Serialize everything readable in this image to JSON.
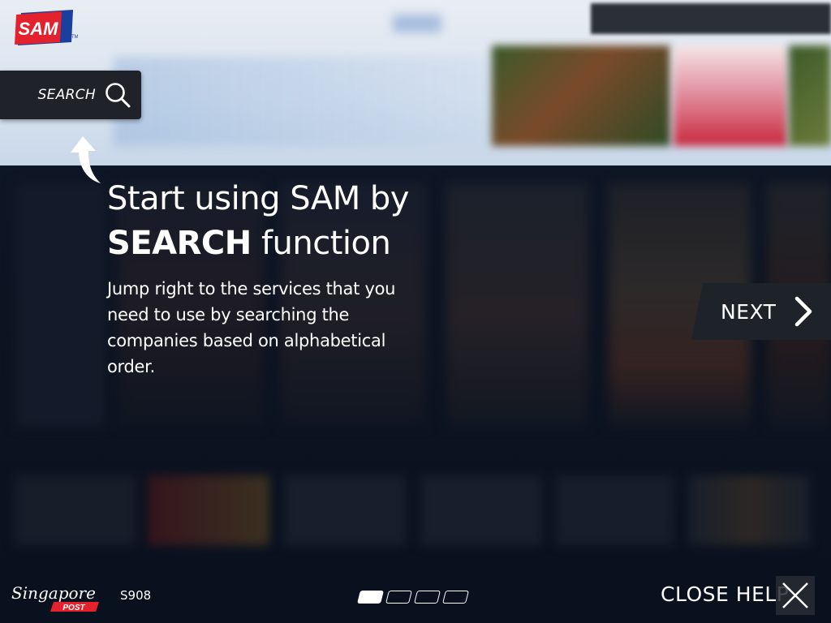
{
  "app": {
    "logo_text": "SAM",
    "logo_tm": "TM",
    "brand_colors": {
      "red": "#e4222e",
      "blue": "#1a3f9c"
    }
  },
  "search_tab": {
    "label": "SEARCH",
    "icon": "search-icon"
  },
  "help": {
    "headline_line1": "Start using SAM by",
    "headline_bold": "SEARCH",
    "headline_rest": " function",
    "description": "Jump right to the services that you need to use by searching the companies based on alphabetical order.",
    "next_label": "NEXT",
    "next_icon": "chevron-right-icon",
    "close_label": "CLOSE HELP",
    "close_icon": "close-icon",
    "pager": {
      "total": 4,
      "current": 1
    }
  },
  "footer": {
    "provider_logo_script": "Singapore",
    "provider_logo_post": "POST",
    "kiosk_id": "S908"
  }
}
